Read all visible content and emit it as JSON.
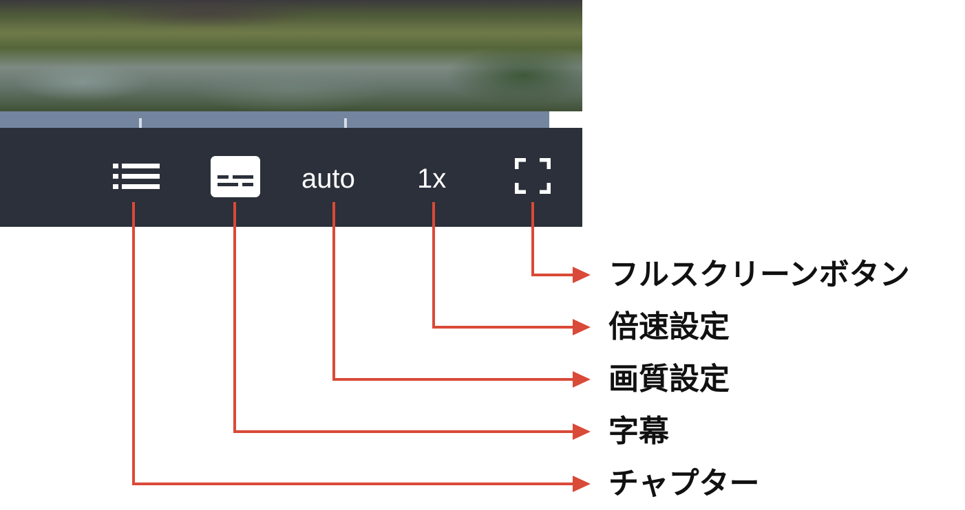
{
  "player": {
    "controls": {
      "chapters_icon": "list-icon",
      "subtitles_icon": "subtitles-icon",
      "quality_label": "auto",
      "speed_label": "1x",
      "fullscreen_icon": "fullscreen-icon"
    },
    "colors": {
      "control_bar": "#2b303b",
      "progress_track": "#7485a0",
      "icon": "#ffffff"
    }
  },
  "annotations": {
    "color": "#d94a38",
    "labels": {
      "fullscreen": "フルスクリーンボタン",
      "speed": "倍速設定",
      "quality": "画質設定",
      "subtitles": "字幕",
      "chapters": "チャプター"
    }
  }
}
